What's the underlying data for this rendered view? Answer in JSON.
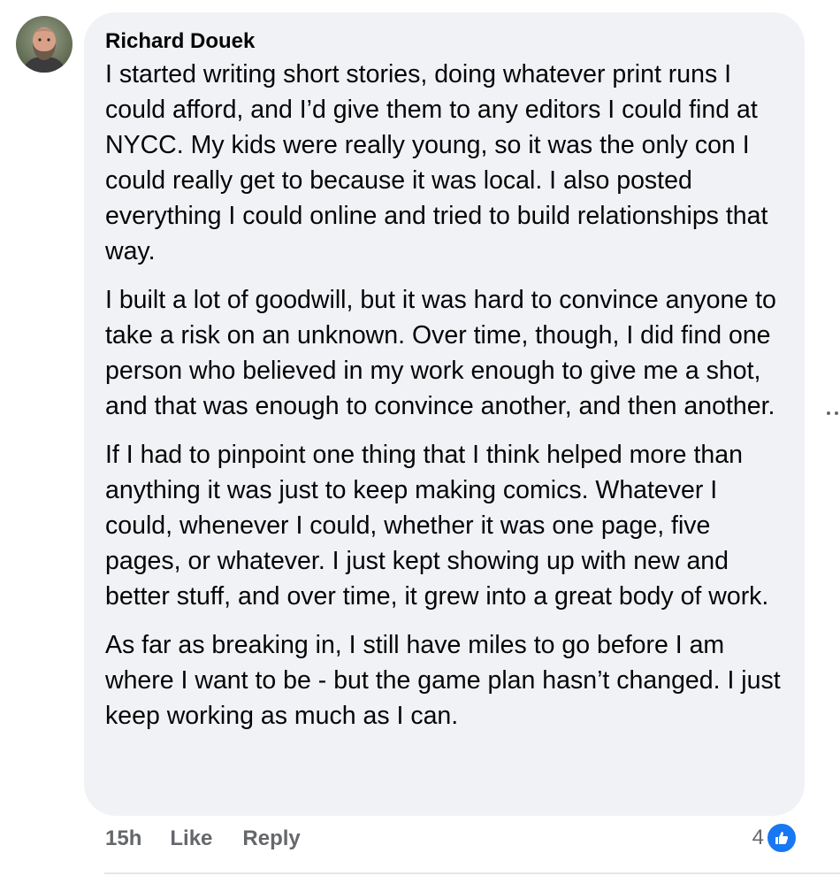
{
  "comment": {
    "author": "Richard Douek",
    "paragraphs": [
      "I started writing short stories, doing whatever print runs I could afford, and I’d give them to any editors I could find at NYCC. My kids were really young, so it was the only con I could really get to because it was local. I also posted everything I could online and tried to build relationships that way.",
      "I built a lot of goodwill, but it was hard to convince anyone to take a risk on an unknown. Over time, though, I did find one person who believed in my work enough to give me a shot, and that was enough to convince another, and then another.",
      "If I had to pinpoint one thing that I think helped more than anything it was just to keep making comics. Whatever I could, whenever I could, whether it was one page, five pages, or whatever. I just kept showing up with new and better stuff, and over time, it grew into a great body of work.",
      "As far as breaking in, I still have miles to go before I am where I want to be - but the game plan hasn’t changed. I just keep working as much as I can."
    ],
    "timestamp": "15h",
    "like_label": "Like",
    "reply_label": "Reply",
    "reaction_count": "4"
  },
  "icons": {
    "avatar": "avatar-photo",
    "more": "more-options-icon",
    "reaction": "like-thumb-icon"
  },
  "colors": {
    "bubble": "#f0f2f5",
    "text": "#050505",
    "secondary_text": "#65676b",
    "like_blue": "#1877f2"
  }
}
